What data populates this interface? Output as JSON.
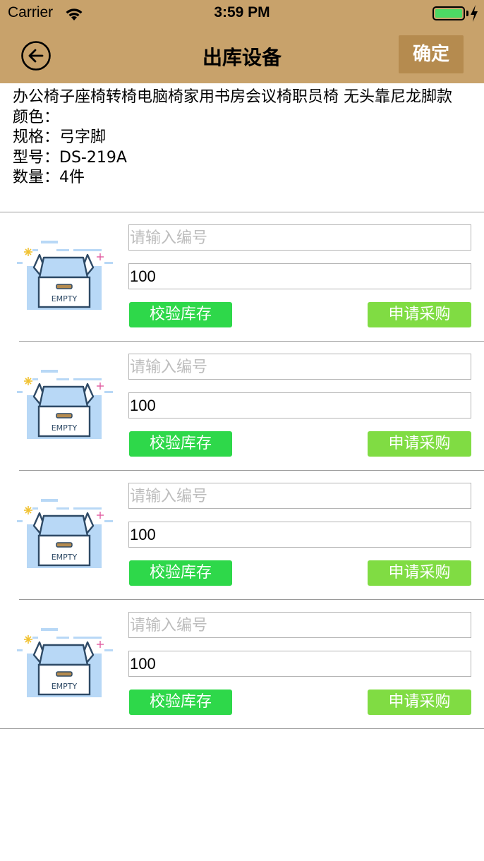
{
  "status_bar": {
    "carrier": "Carrier",
    "time": "3:59 PM",
    "battery_level": 1.0,
    "battery_color": "#4cd964"
  },
  "nav": {
    "title": "出库设备",
    "confirm_label": "确定",
    "back_icon": "circle-arrow-left-icon",
    "bg_color": "#c8a26b"
  },
  "product": {
    "name": "办公椅子座椅转椅电脑椅家用书房会议椅职员椅 无头靠尼龙脚款",
    "color_line": "颜色：",
    "spec_line": "规格：弓字脚",
    "model_line": "型号：DS-219A",
    "qty_line": "数量：4件"
  },
  "items": [
    {
      "code_placeholder": "请输入编号",
      "code_value": "",
      "quantity": "100",
      "check_label": "校验库存",
      "purchase_label": "申请采购",
      "image_label": "EMPTY"
    },
    {
      "code_placeholder": "请输入编号",
      "code_value": "",
      "quantity": "100",
      "check_label": "校验库存",
      "purchase_label": "申请采购",
      "image_label": "EMPTY"
    },
    {
      "code_placeholder": "请输入编号",
      "code_value": "",
      "quantity": "100",
      "check_label": "校验库存",
      "purchase_label": "申请采购",
      "image_label": "EMPTY"
    },
    {
      "code_placeholder": "请输入编号",
      "code_value": "",
      "quantity": "100",
      "check_label": "校验库存",
      "purchase_label": "申请采购",
      "image_label": "EMPTY"
    }
  ],
  "colors": {
    "check_button": "#2ed84a",
    "purchase_button": "#80dc43",
    "confirm_button": "#b58b4f"
  }
}
